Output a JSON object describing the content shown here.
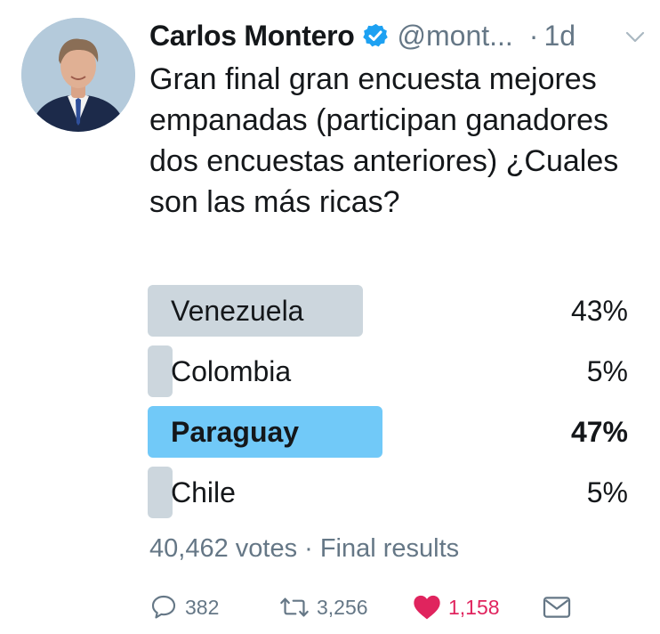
{
  "tweet": {
    "author": {
      "display_name": "Carlos Montero",
      "handle": "@mont...",
      "verified_icon": "verified-badge-icon"
    },
    "separator": "·",
    "timestamp": "1d",
    "text": "Gran final gran encuesta mejores empanadas (participan ganadores dos encuestas anteriores) ¿Cuales son las más ricas?"
  },
  "poll": {
    "options": [
      {
        "label": "Venezuela",
        "percent_text": "43%",
        "percent": 43,
        "winner": false
      },
      {
        "label": "Colombia",
        "percent_text": "5%",
        "percent": 5,
        "winner": false
      },
      {
        "label": "Paraguay",
        "percent_text": "47%",
        "percent": 47,
        "winner": true
      },
      {
        "label": "Chile",
        "percent_text": "5%",
        "percent": 5,
        "winner": false
      }
    ],
    "summary": "40,462 votes · Final results"
  },
  "actions": {
    "reply_count": "382",
    "retweet_count": "3,256",
    "like_count": "1,158",
    "icons": [
      "reply-icon",
      "retweet-icon",
      "heart-icon",
      "message-icon"
    ]
  },
  "colors": {
    "text": "#14171a",
    "secondary": "#657786",
    "poll_bar": "#ccd6dd",
    "poll_winner_bar": "#71c9f8",
    "verified": "#1da1f2",
    "like": "#e0245e"
  }
}
